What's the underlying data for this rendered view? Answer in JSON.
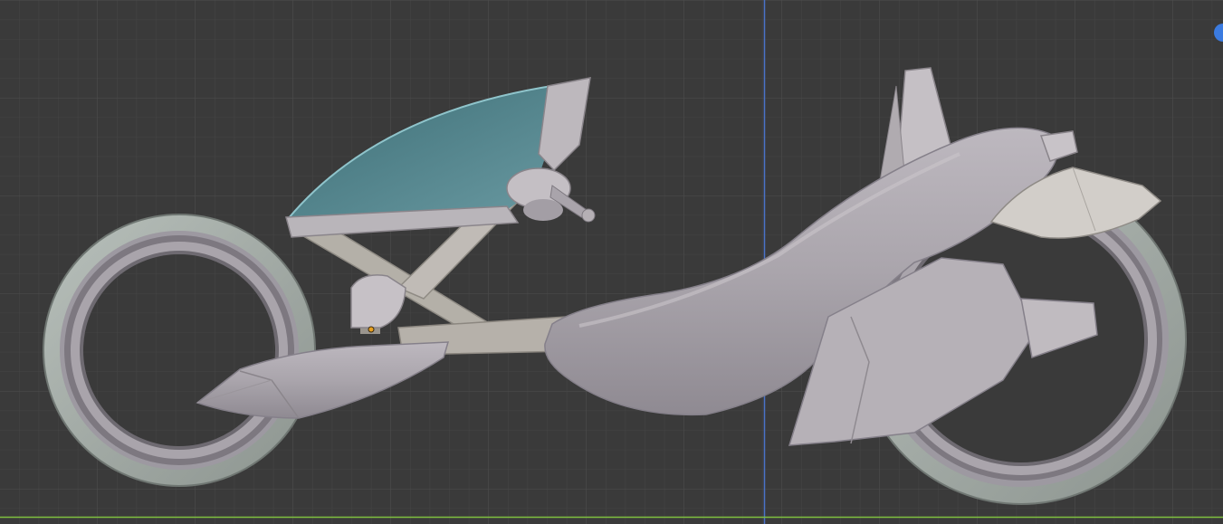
{
  "viewport": {
    "view": "orthographic-side",
    "background_color": "#3a3a3a",
    "grid_minor_color": "#444444",
    "grid_major_color": "#4e4e4e",
    "axis_vertical_color": "#4a72c8",
    "axis_horizontal_color": "#7fbf3f"
  },
  "model": {
    "name_semantic": "futuristic-hubless-motorcycle",
    "body_color": "#a9a4ab",
    "tire_color": "#a8b0aa",
    "windshield_color": "#4f8790",
    "origin_dot_color": "#e8a020"
  },
  "gizmo": {
    "icon": "navigation-gizmo-icon",
    "color": "#3b7be0"
  }
}
